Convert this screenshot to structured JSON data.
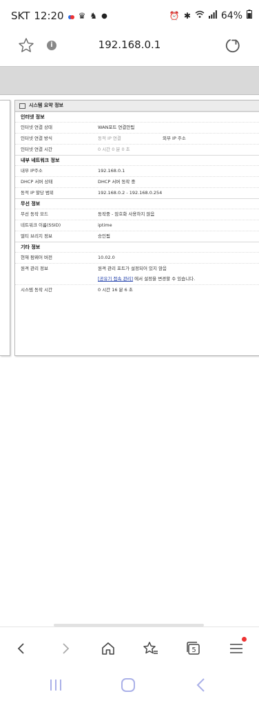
{
  "status": {
    "carrier": "SKT",
    "time": "12:20",
    "battery": "64%"
  },
  "browser": {
    "url": "192.168.0.1",
    "tab_count": "5"
  },
  "panel": {
    "title": "시스템 요약 정보",
    "internet": {
      "heading": "인터넷 정보",
      "rows": [
        {
          "k": "인터넷 연결 상태",
          "v": "WAN포트 연결안됨",
          "v2": ""
        },
        {
          "k": "인터넷 연결 방식",
          "v": "동적 IP 연결",
          "v2": "외부 IP 주소"
        },
        {
          "k": "인터넷 연결 시간",
          "v": "0 시간 0 분 0 초",
          "v2": ""
        }
      ]
    },
    "internal": {
      "heading": "내부 네트워크 정보",
      "rows": [
        {
          "k": "내부 IP주소",
          "v": "192.168.0.1"
        },
        {
          "k": "DHCP 서버 상태",
          "v": "DHCP 서버 동작 중"
        },
        {
          "k": "동적 IP 할당 범위",
          "v": "192.168.0.2 - 192.168.0.254"
        }
      ]
    },
    "wireless": {
      "heading": "무선 정보",
      "rows": [
        {
          "k": "무선 동작 모드",
          "v": "동작중 - 암호화 사용하지 않음"
        },
        {
          "k": "네트워크 이름(SSID)",
          "v": "iptime"
        },
        {
          "k": "멀티 브리지 정보",
          "v": "승인됨"
        }
      ]
    },
    "other": {
      "heading": "기타 정보",
      "rows": [
        {
          "k": "현재 펌웨어 버전",
          "v": "10.02.0"
        },
        {
          "k": "원격 관리 정보",
          "v": "원격 관리 포트가 설정되어 있지 않음"
        }
      ],
      "link": "[공유기 접속 관리]",
      "link_suffix": "에서 설정을 변경할 수 있습니다.",
      "uptime_k": "시스템 동작 시간",
      "uptime_v": "0 시간 16 분 6 초"
    }
  }
}
